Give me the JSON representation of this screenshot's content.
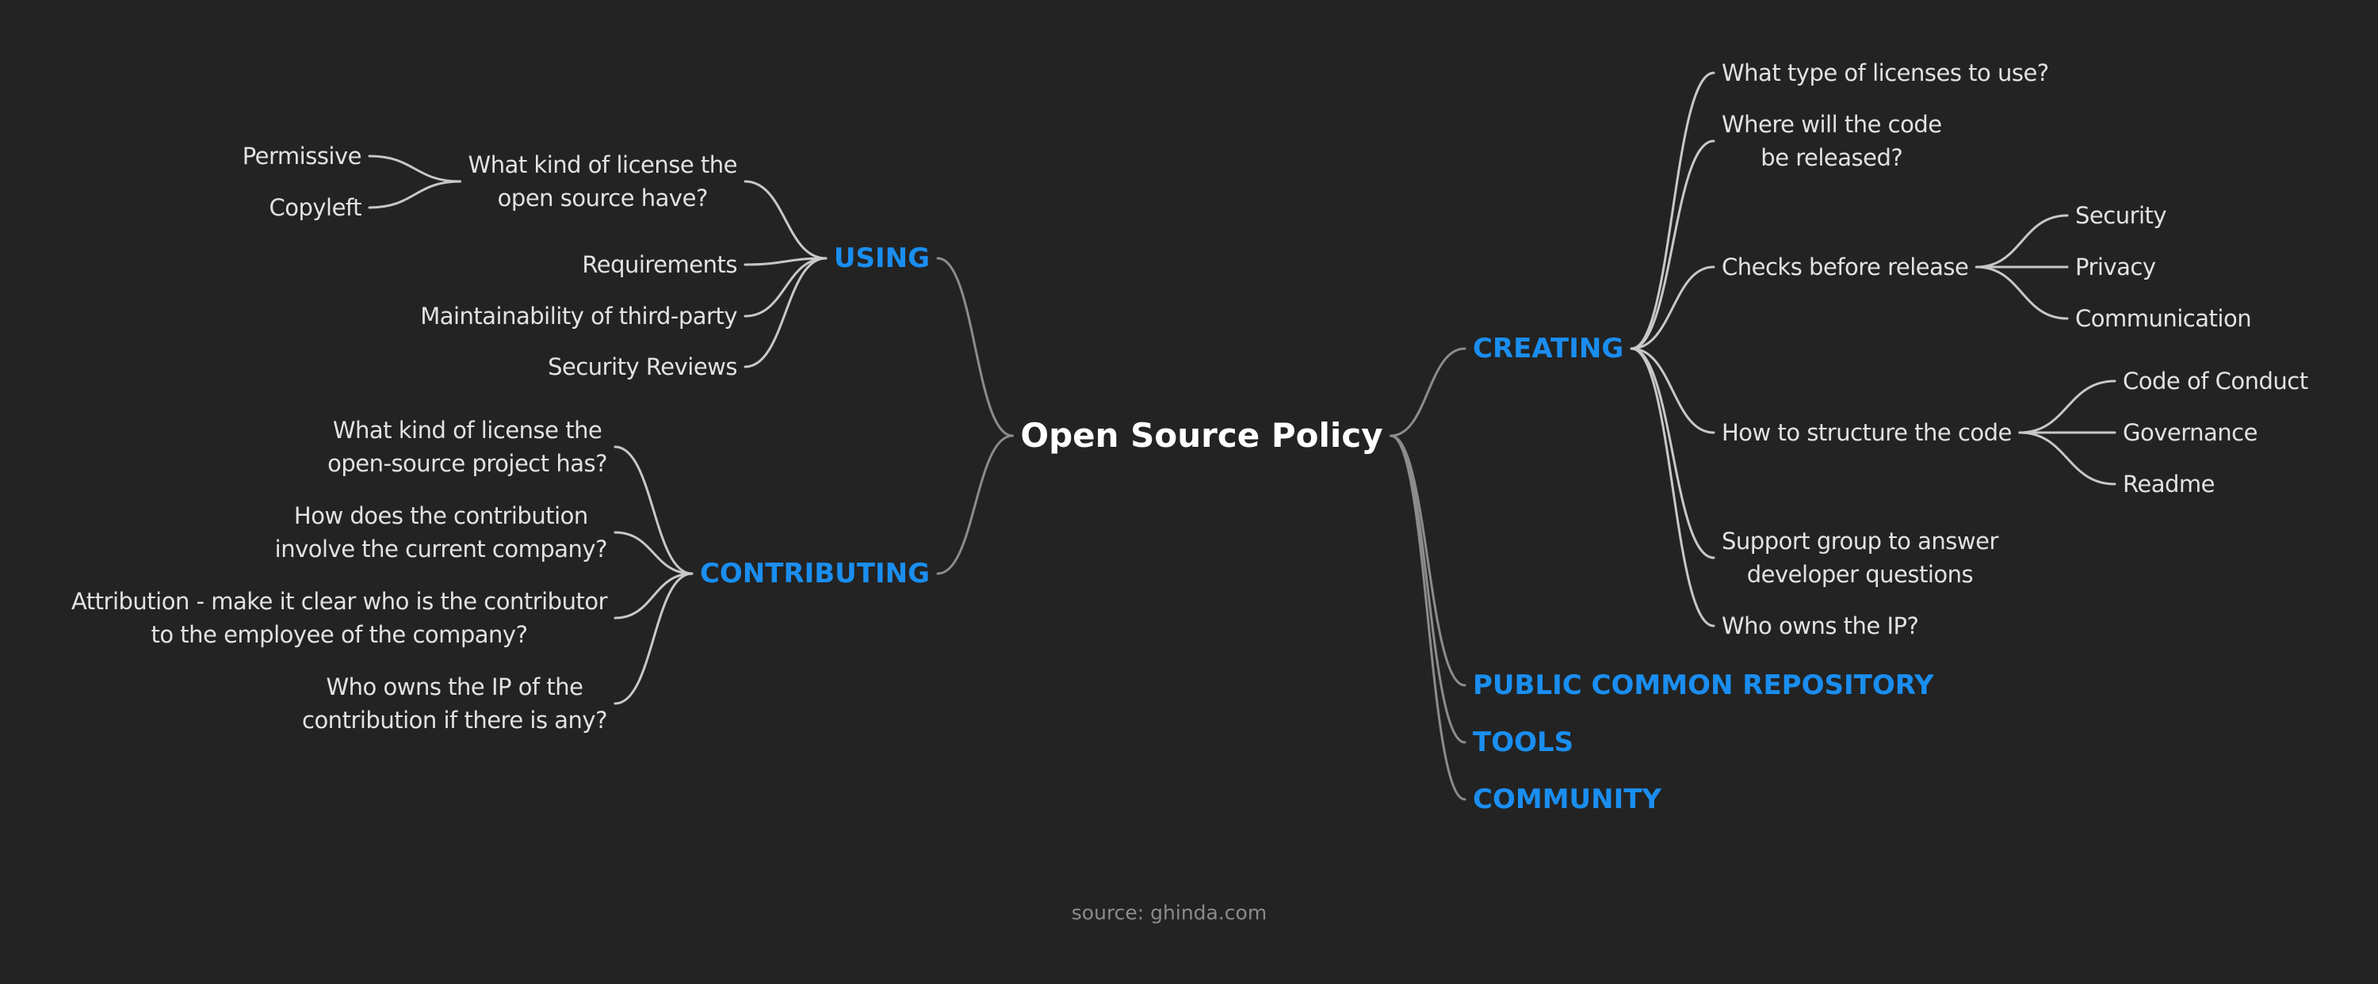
{
  "colors": {
    "background": "#232323",
    "root_text": "#ffffff",
    "main_topic": "#1a8ef0",
    "subtopic_text": "#e2e2e2",
    "root_link": "#8c8c8c",
    "sub_link": "#c8c8c8",
    "footer_text": "#8b8b8b"
  },
  "root": {
    "id": "root",
    "label": "Open Source Policy"
  },
  "left_branches": [
    {
      "id": "using",
      "label": "USING",
      "children": [
        {
          "id": "using-license",
          "label": "What kind of license the\nopen source have?",
          "children": [
            {
              "id": "using-permissive",
              "label": "Permissive"
            },
            {
              "id": "using-copyleft",
              "label": "Copyleft"
            }
          ]
        },
        {
          "id": "using-requirements",
          "label": "Requirements"
        },
        {
          "id": "using-maintainability",
          "label": "Maintainability of third-party"
        },
        {
          "id": "using-security-reviews",
          "label": "Security Reviews"
        }
      ]
    },
    {
      "id": "contributing",
      "label": "CONTRIBUTING",
      "children": [
        {
          "id": "contrib-license",
          "label": "What kind of license the\nopen-source project has?"
        },
        {
          "id": "contrib-company",
          "label": "How does the contribution\ninvolve the current company?"
        },
        {
          "id": "contrib-attribution",
          "label": "Attribution - make it clear who is the contributor\nto the employee of the company?"
        },
        {
          "id": "contrib-ip",
          "label": "Who owns the IP of the\ncontribution if there is any?"
        }
      ]
    }
  ],
  "right_branches": [
    {
      "id": "creating",
      "label": "CREATING",
      "children": [
        {
          "id": "creating-license-type",
          "label": "What type of licenses to use?"
        },
        {
          "id": "creating-where",
          "label": "Where will the code\nbe released?"
        },
        {
          "id": "creating-checks",
          "label": "Checks before release",
          "children": [
            {
              "id": "checks-security",
              "label": "Security"
            },
            {
              "id": "checks-privacy",
              "label": "Privacy"
            },
            {
              "id": "checks-communication",
              "label": "Communication"
            }
          ]
        },
        {
          "id": "creating-structure",
          "label": "How to structure the code",
          "children": [
            {
              "id": "structure-coc",
              "label": "Code of Conduct"
            },
            {
              "id": "structure-governance",
              "label": "Governance"
            },
            {
              "id": "structure-readme",
              "label": "Readme"
            }
          ]
        },
        {
          "id": "creating-support",
          "label": "Support group to answer\ndeveloper questions"
        },
        {
          "id": "creating-ip",
          "label": "Who owns the IP?"
        }
      ]
    },
    {
      "id": "public-repo",
      "label": "PUBLIC COMMON REPOSITORY",
      "children": []
    },
    {
      "id": "tools",
      "label": "TOOLS",
      "children": []
    },
    {
      "id": "community",
      "label": "COMMUNITY",
      "children": []
    }
  ],
  "footer": {
    "source": "source: ghinda.com"
  }
}
